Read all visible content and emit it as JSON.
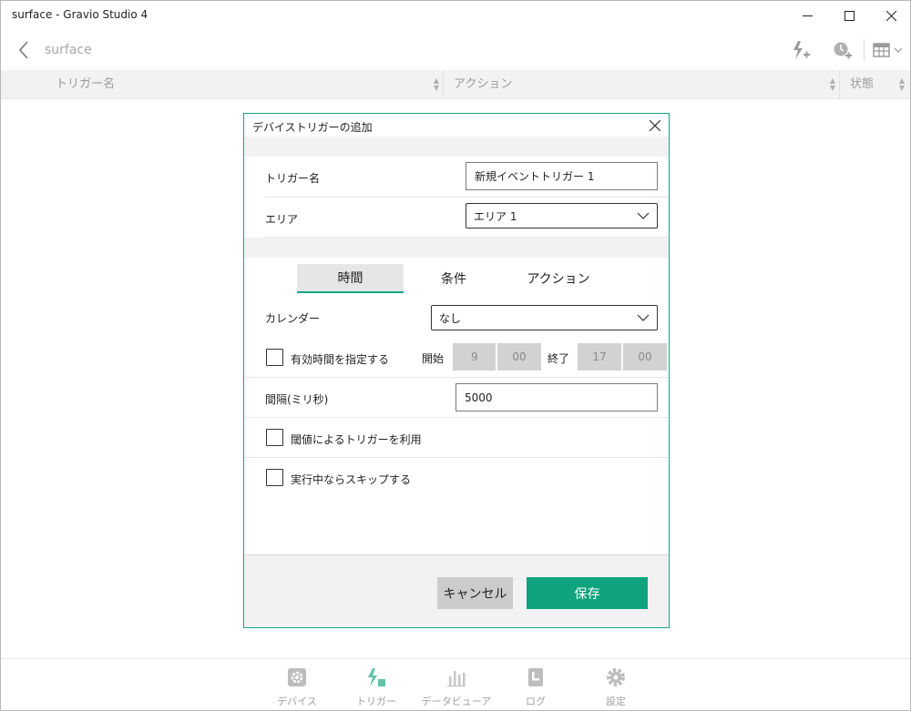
{
  "window": {
    "title": "surface - Gravio Studio 4"
  },
  "nav": {
    "title": "surface"
  },
  "table": {
    "columns": [
      "トリガー名",
      "アクション",
      "状態"
    ]
  },
  "dialog": {
    "title": "デバイストリガーの追加",
    "trigger_name": {
      "label": "トリガー名",
      "value": "新規イベントトリガー 1"
    },
    "area": {
      "label": "エリア",
      "value": "エリア 1"
    },
    "tabs": [
      {
        "label": "時間",
        "active": true
      },
      {
        "label": "条件",
        "active": false
      },
      {
        "label": "アクション",
        "active": false
      }
    ],
    "calendar": {
      "label": "カレンダー",
      "value": "なし"
    },
    "valid_time": {
      "label": "有効時間を指定する",
      "checked": false,
      "start_label": "開始",
      "start_hour": "9",
      "start_min": "00",
      "end_label": "終了",
      "end_hour": "17",
      "end_min": "00"
    },
    "interval": {
      "label": "間隔(ミリ秒)",
      "value": "5000"
    },
    "threshold": {
      "label": "閾値によるトリガーを利用",
      "checked": false
    },
    "skip": {
      "label": "実行中ならスキップする",
      "checked": false
    },
    "cancel_label": "キャンセル",
    "save_label": "保存"
  },
  "bottom_nav": [
    {
      "label": "デバイス",
      "icon": "gear-square-icon",
      "active": false
    },
    {
      "label": "トリガー",
      "icon": "trigger-icon",
      "active": true
    },
    {
      "label": "データビューア",
      "icon": "bar-chart-icon",
      "active": false
    },
    {
      "label": "ログ",
      "icon": "log-icon",
      "active": false
    },
    {
      "label": "設定",
      "icon": "gear-icon",
      "active": false
    }
  ],
  "colors": {
    "accent": "#0fa47e",
    "dialog_border": "#1ba684"
  }
}
